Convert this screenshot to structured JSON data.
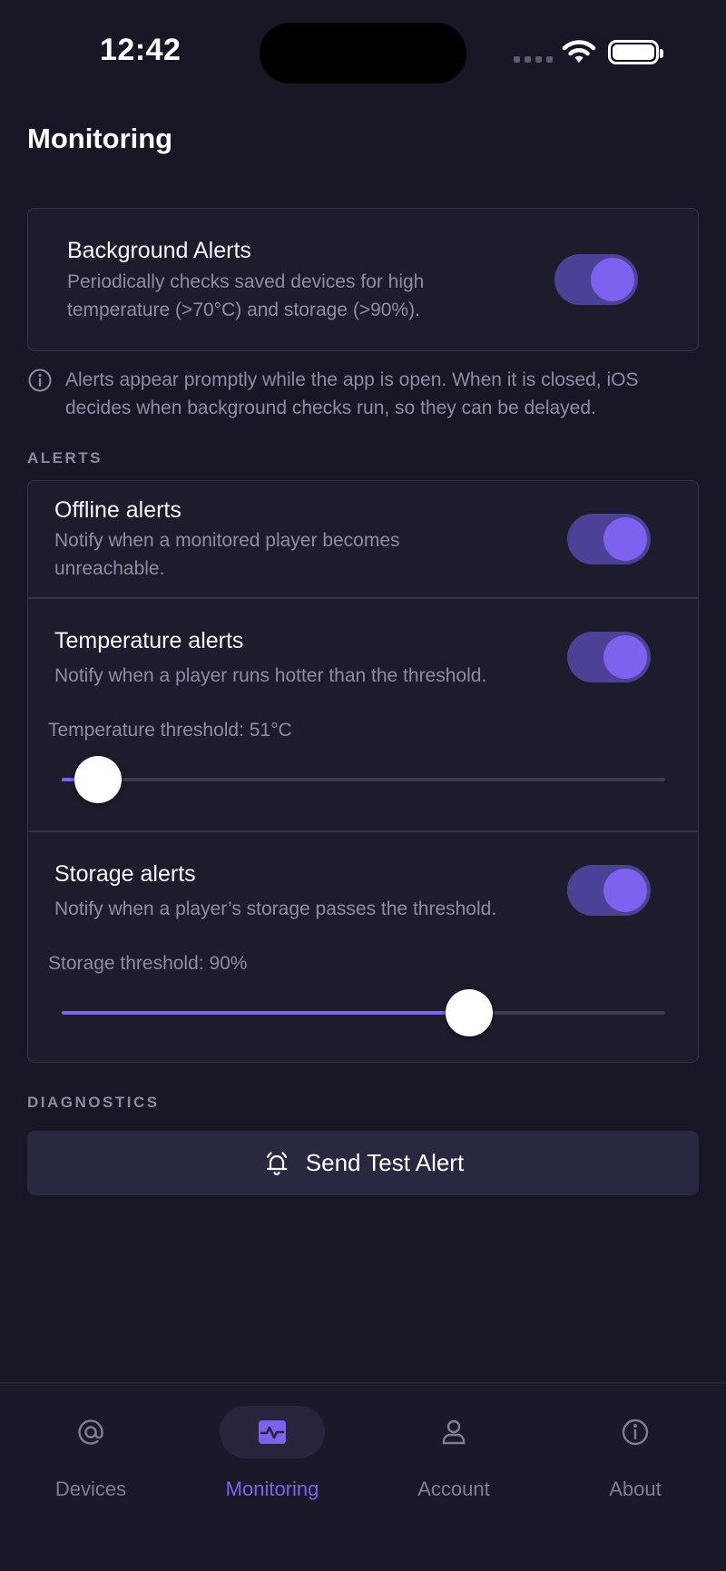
{
  "status_bar": {
    "time": "12:42"
  },
  "page_title": "Monitoring",
  "background_alerts": {
    "title": "Background Alerts",
    "description": "Periodically checks saved devices for high temperature (>70°C) and storage (>90%).",
    "enabled": true
  },
  "info_note": "Alerts appear promptly while the app is open. When it is closed, iOS decides when background checks run, so they can be delayed.",
  "alerts_section": {
    "label": "ALERTS",
    "offline": {
      "title": "Offline alerts",
      "description": "Notify when a monitored player becomes unreachable.",
      "enabled": true
    },
    "temperature": {
      "title": "Temperature alerts",
      "description": "Notify when a player runs hotter than the threshold.",
      "enabled": true,
      "threshold_label": "Temperature threshold: 51°C",
      "slider_fraction": 0.06
    },
    "storage": {
      "title": "Storage alerts",
      "description": "Notify when a player’s storage passes the threshold.",
      "enabled": true,
      "threshold_label": "Storage threshold: 90%",
      "slider_fraction": 0.675
    }
  },
  "diagnostics": {
    "label": "DIAGNOSTICS",
    "button_label": "Send Test Alert",
    "button_icon": "bell-ringing-icon"
  },
  "tabbar": {
    "tabs": [
      {
        "label": "Devices",
        "icon": "at-sign-icon",
        "active": false
      },
      {
        "label": "Monitoring",
        "icon": "activity-icon",
        "active": true
      },
      {
        "label": "Account",
        "icon": "user-icon",
        "active": false
      },
      {
        "label": "About",
        "icon": "info-icon",
        "active": false
      }
    ]
  },
  "colors": {
    "accent": "#7c62ee",
    "toggle_track": "#4b4296",
    "background": "#181726"
  }
}
